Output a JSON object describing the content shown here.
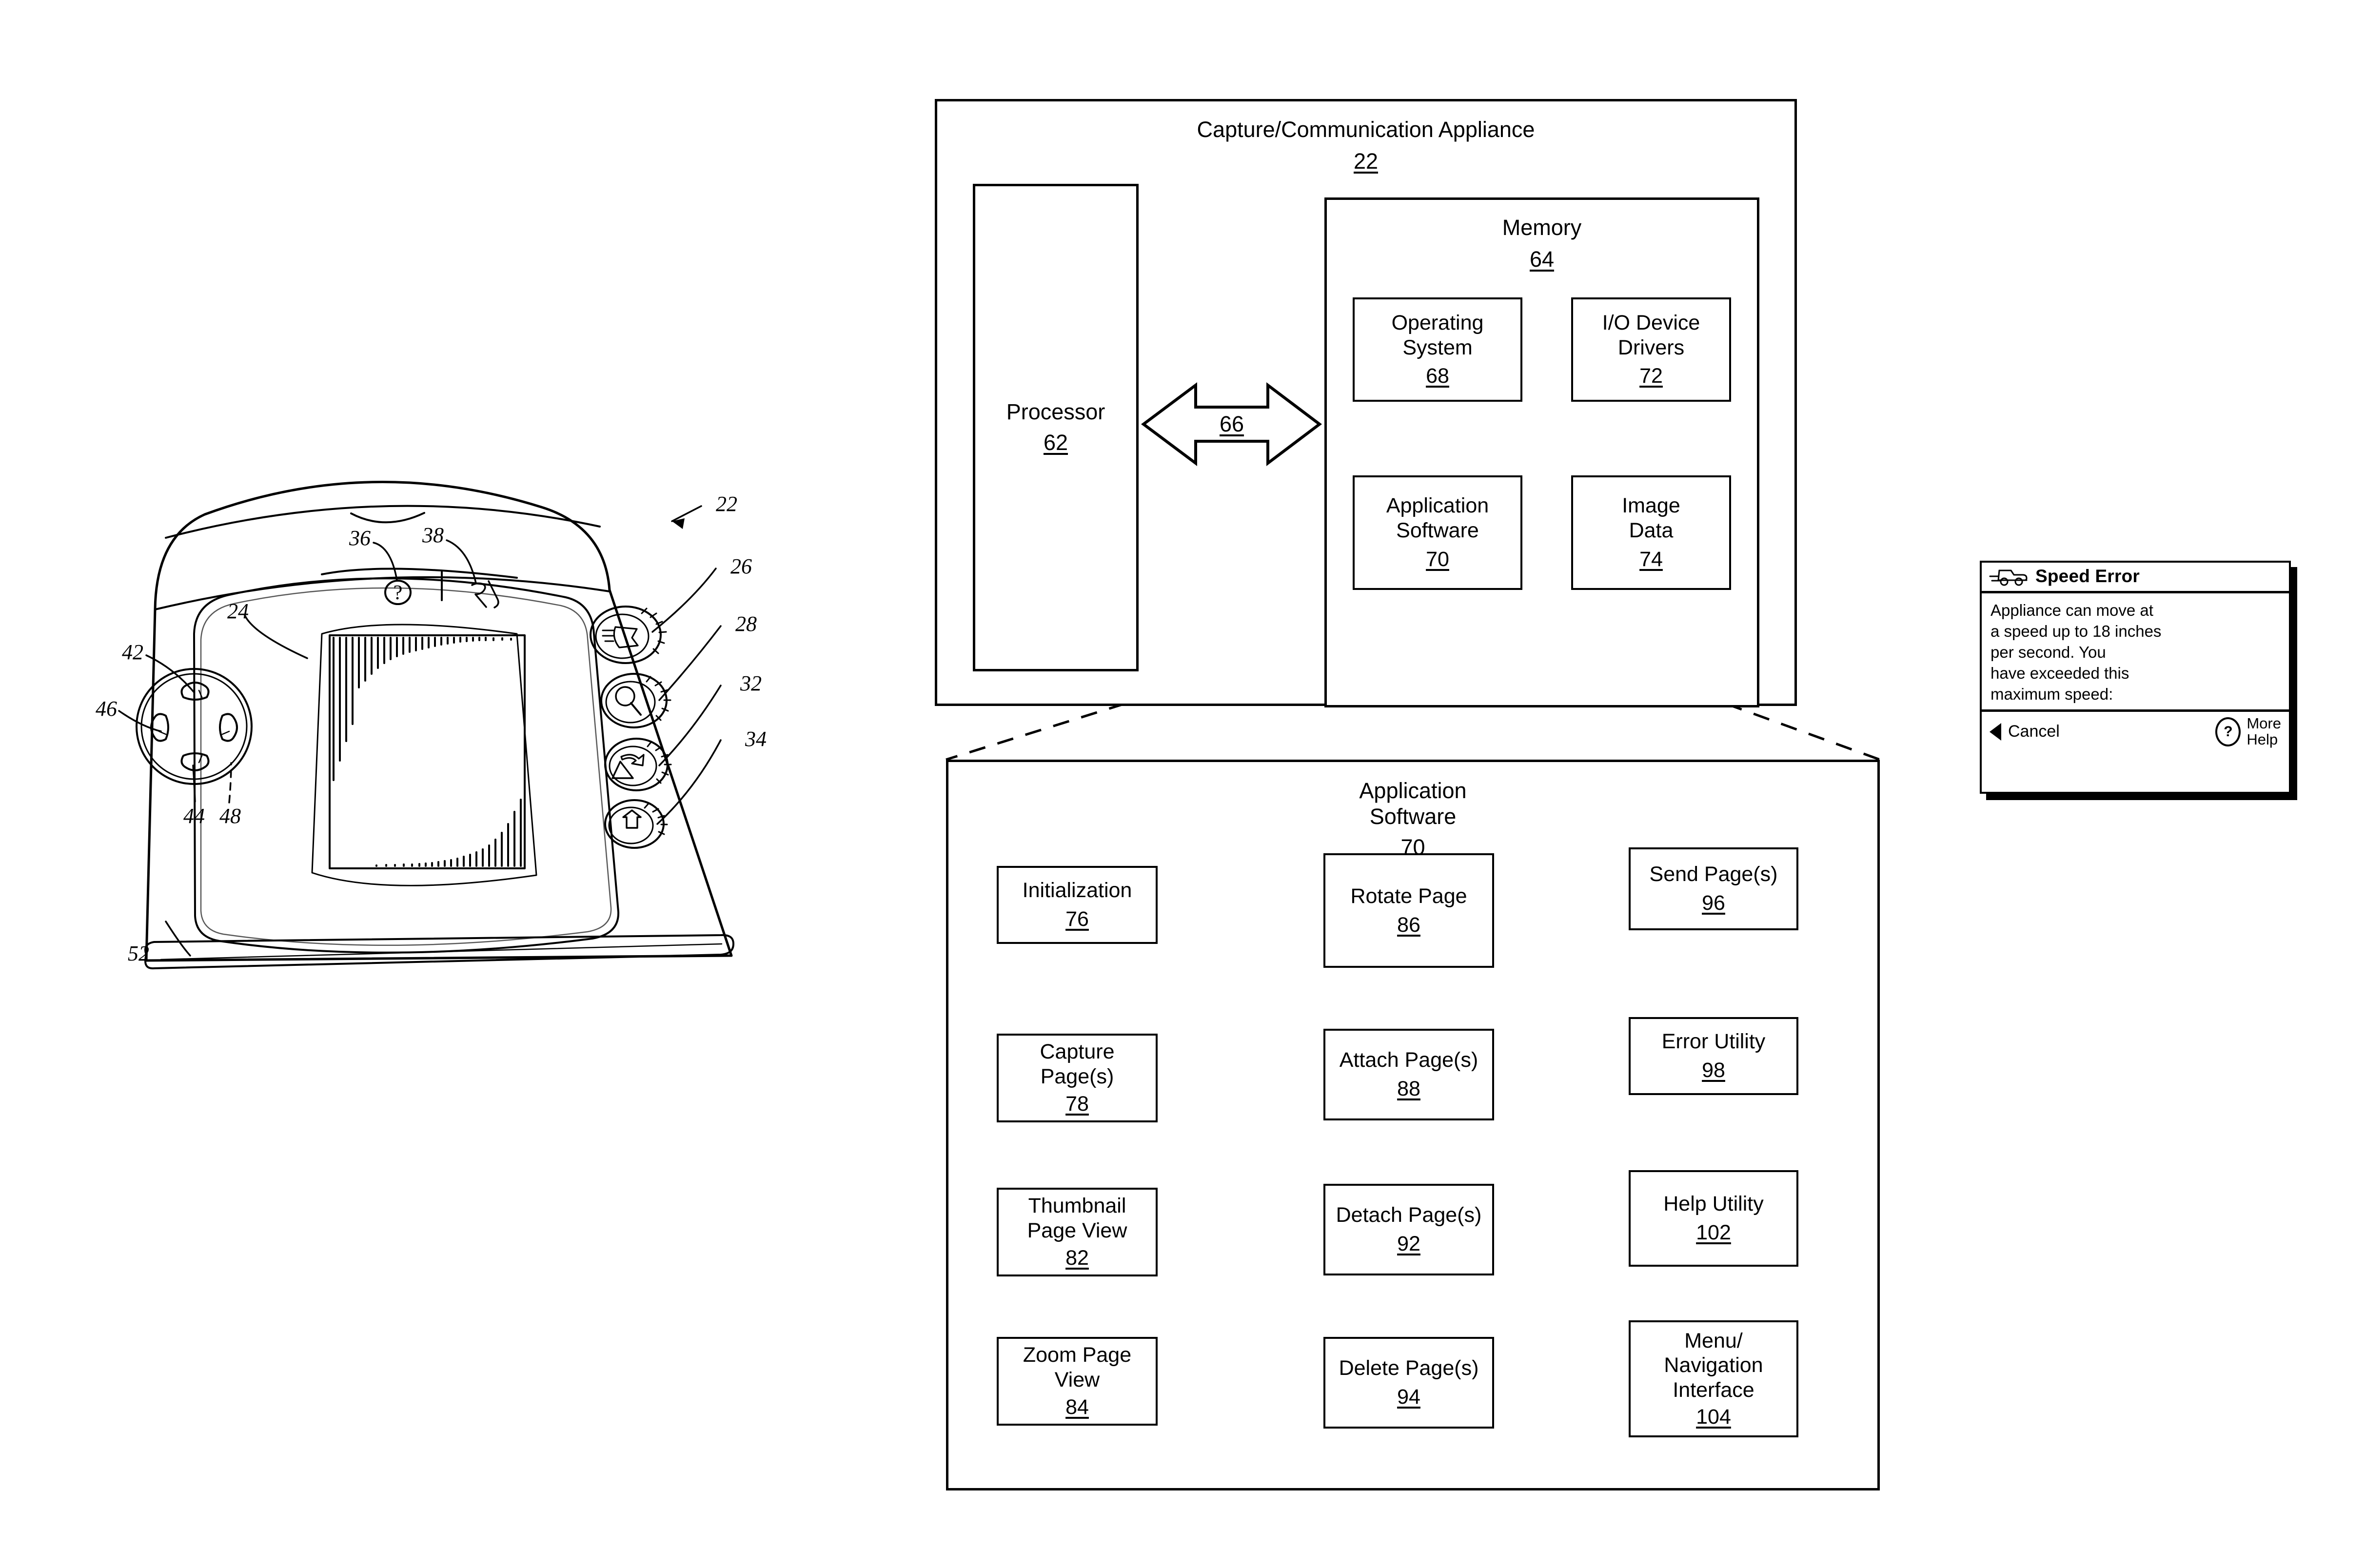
{
  "figure": {
    "appliance_box": {
      "title": "Capture/Communication Appliance",
      "ref": "22"
    },
    "processor": {
      "label": "Processor",
      "ref": "62"
    },
    "bus": {
      "ref": "66"
    },
    "memory": {
      "label": "Memory",
      "ref": "64"
    },
    "memory_items": [
      {
        "label": "Operating\nSystem",
        "line1": "Operating",
        "line2": "System",
        "ref": "68"
      },
      {
        "label": "I/O Device Drivers",
        "line1": "I/O Device",
        "line2": "Drivers",
        "ref": "72"
      },
      {
        "label": "Application Software",
        "line1": "Application",
        "line2": "Software",
        "ref": "70"
      },
      {
        "label": "Image Data",
        "line1": "Image",
        "line2": "Data",
        "ref": "74"
      }
    ],
    "app_software_box": {
      "line1": "Application",
      "line2": "Software",
      "ref": "70"
    },
    "app_modules": [
      {
        "line1": "Initialization",
        "line2": "",
        "line3": "",
        "ref": "76"
      },
      {
        "line1": "Capture",
        "line2": "Page(s)",
        "line3": "",
        "ref": "78"
      },
      {
        "line1": "Thumbnail",
        "line2": "Page View",
        "line3": "",
        "ref": "82"
      },
      {
        "line1": "Zoom Page",
        "line2": "View",
        "line3": "",
        "ref": "84"
      },
      {
        "line1": "Rotate Page",
        "line2": "",
        "line3": "",
        "ref": "86"
      },
      {
        "line1": "Attach Page(s)",
        "line2": "",
        "line3": "",
        "ref": "88"
      },
      {
        "line1": "Detach Page(s)",
        "line2": "",
        "line3": "",
        "ref": "92"
      },
      {
        "line1": "Delete Page(s)",
        "line2": "",
        "line3": "",
        "ref": "94"
      },
      {
        "line1": "Send Page(s)",
        "line2": "",
        "line3": "",
        "ref": "96"
      },
      {
        "line1": "Error Utility",
        "line2": "",
        "line3": "",
        "ref": "98"
      },
      {
        "line1": "Help Utility",
        "line2": "",
        "line3": "",
        "ref": "102"
      },
      {
        "line1": "Menu/",
        "line2": "Navigation",
        "line3": "Interface",
        "ref": "104"
      }
    ],
    "device_callouts": [
      {
        "num": "22"
      },
      {
        "num": "36"
      },
      {
        "num": "38"
      },
      {
        "num": "26"
      },
      {
        "num": "24"
      },
      {
        "num": "28"
      },
      {
        "num": "42"
      },
      {
        "num": "32"
      },
      {
        "num": "46"
      },
      {
        "num": "34"
      },
      {
        "num": "44"
      },
      {
        "num": "48"
      },
      {
        "num": "52"
      }
    ]
  },
  "dialog": {
    "title": "Speed Error",
    "icon": "moving-vehicle-icon",
    "body_lines": [
      "Appliance can move at",
      "a speed up to 18 inches",
      "per second. You",
      "have exceeded this",
      "maximum speed:"
    ],
    "cancel_label": "Cancel",
    "help_line1": "More",
    "help_line2": "Help",
    "help_glyph": "?"
  },
  "colors": {
    "ink": "#000000",
    "paper": "#ffffff"
  }
}
